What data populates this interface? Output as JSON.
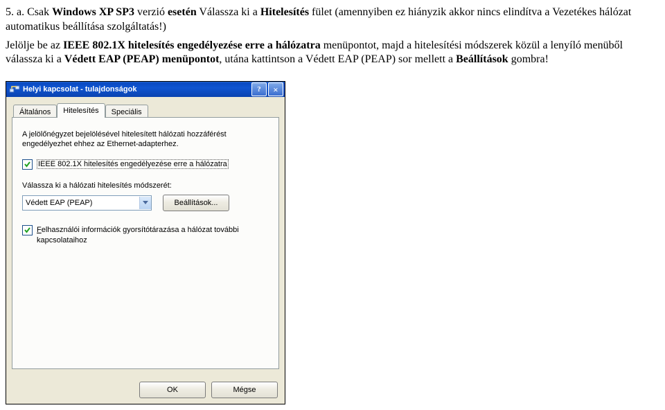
{
  "step": {
    "num": "5. a.",
    "t1a": "Csak ",
    "t1b": "Windows XP SP3",
    "t1c": " verzió ",
    "t1d": "esetén",
    "t1e": " Válassza ki a ",
    "t1f": "Hitelesítés",
    "t1g": " fület (amennyiben ez hiányzik akkor nincs elindítva a Vezetékes hálózat automatikus beállítása szolgáltatás!)",
    "t2a": "Jelölje be az ",
    "t2b": "IEEE 802.1X hitelesítés engedélyezése erre a hálózatra",
    "t2c": " menüpontot, majd a hitelesítési módszerek közül a lenyíló menüből válassza ki a ",
    "t2d": "Védett EAP (PEAP)",
    "t2e": " menüpontot",
    "t2f": ", utána kattintson a Védett EAP (PEAP) sor mellett a ",
    "t2g": "Beállítások",
    "t2h": " gombra!"
  },
  "dialog": {
    "title": "Helyi kapcsolat - tulajdonságok",
    "help_glyph": "?",
    "close_glyph": "×",
    "tabs": {
      "general": "Általános",
      "auth": "Hitelesítés",
      "advanced": "Speciális"
    },
    "desc": "A jelölőnégyzet bejelölésével hitelesített hálózati hozzáférést engedélyezhet ehhez az Ethernet-adapterhez.",
    "chk_enable": "IEEE 802.1X hitelesítés engedélyezése erre a hálózatra",
    "method_label": "Válassza ki a hálózati hitelesítés módszerét:",
    "method_value": "Védett EAP (PEAP)",
    "settings_btn": "Beállítások...",
    "chk_cache": "Felhasználói információk gyorsítótárazása a hálózat további kapcsolataihoz",
    "ok": "OK",
    "cancel": "Mégse"
  }
}
